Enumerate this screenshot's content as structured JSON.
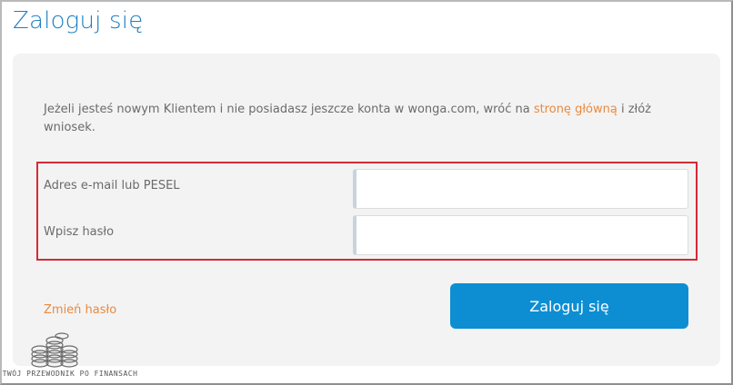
{
  "page": {
    "title": "Zaloguj się"
  },
  "intro": {
    "text_before": "Jeżeli jesteś nowym Klientem i nie posiadasz jeszcze konta w wonga.com, wróć na ",
    "link_text": "stronę główną",
    "text_after": " i złóż wniosek."
  },
  "form": {
    "email_label": "Adres e-mail lub PESEL",
    "email_value": "",
    "password_label": "Wpisz hasło",
    "password_value": "",
    "forgot_link": "Zmień hasło",
    "submit_label": "Zaloguj się"
  },
  "watermark": {
    "text": "TWÓJ PRZEWODNIK PO FINANSACH",
    "icon": "coins-stack-icon"
  },
  "colors": {
    "title": "#1c7fc1",
    "link": "#e98a3e",
    "button": "#0d8ed3",
    "highlight_border": "#d42a35",
    "panel_bg": "#f3f3f3"
  }
}
